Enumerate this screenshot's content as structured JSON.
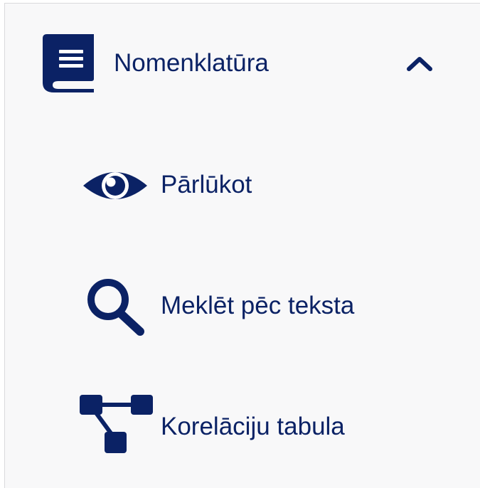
{
  "nav": {
    "section": {
      "label": "Nomenklatūra",
      "icon": "book-icon",
      "expanded": true,
      "toggle_icon": "chevron-up-icon"
    },
    "items": [
      {
        "label": "Pārlūkot",
        "icon": "eye-icon"
      },
      {
        "label": "Meklēt pēc teksta",
        "icon": "search-icon"
      },
      {
        "label": "Korelāciju tabula",
        "icon": "sitemap-icon"
      }
    ]
  },
  "colors": {
    "accent": "#0b2265",
    "panel_background": "#f8f8f9",
    "border": "#d9d9dc"
  }
}
